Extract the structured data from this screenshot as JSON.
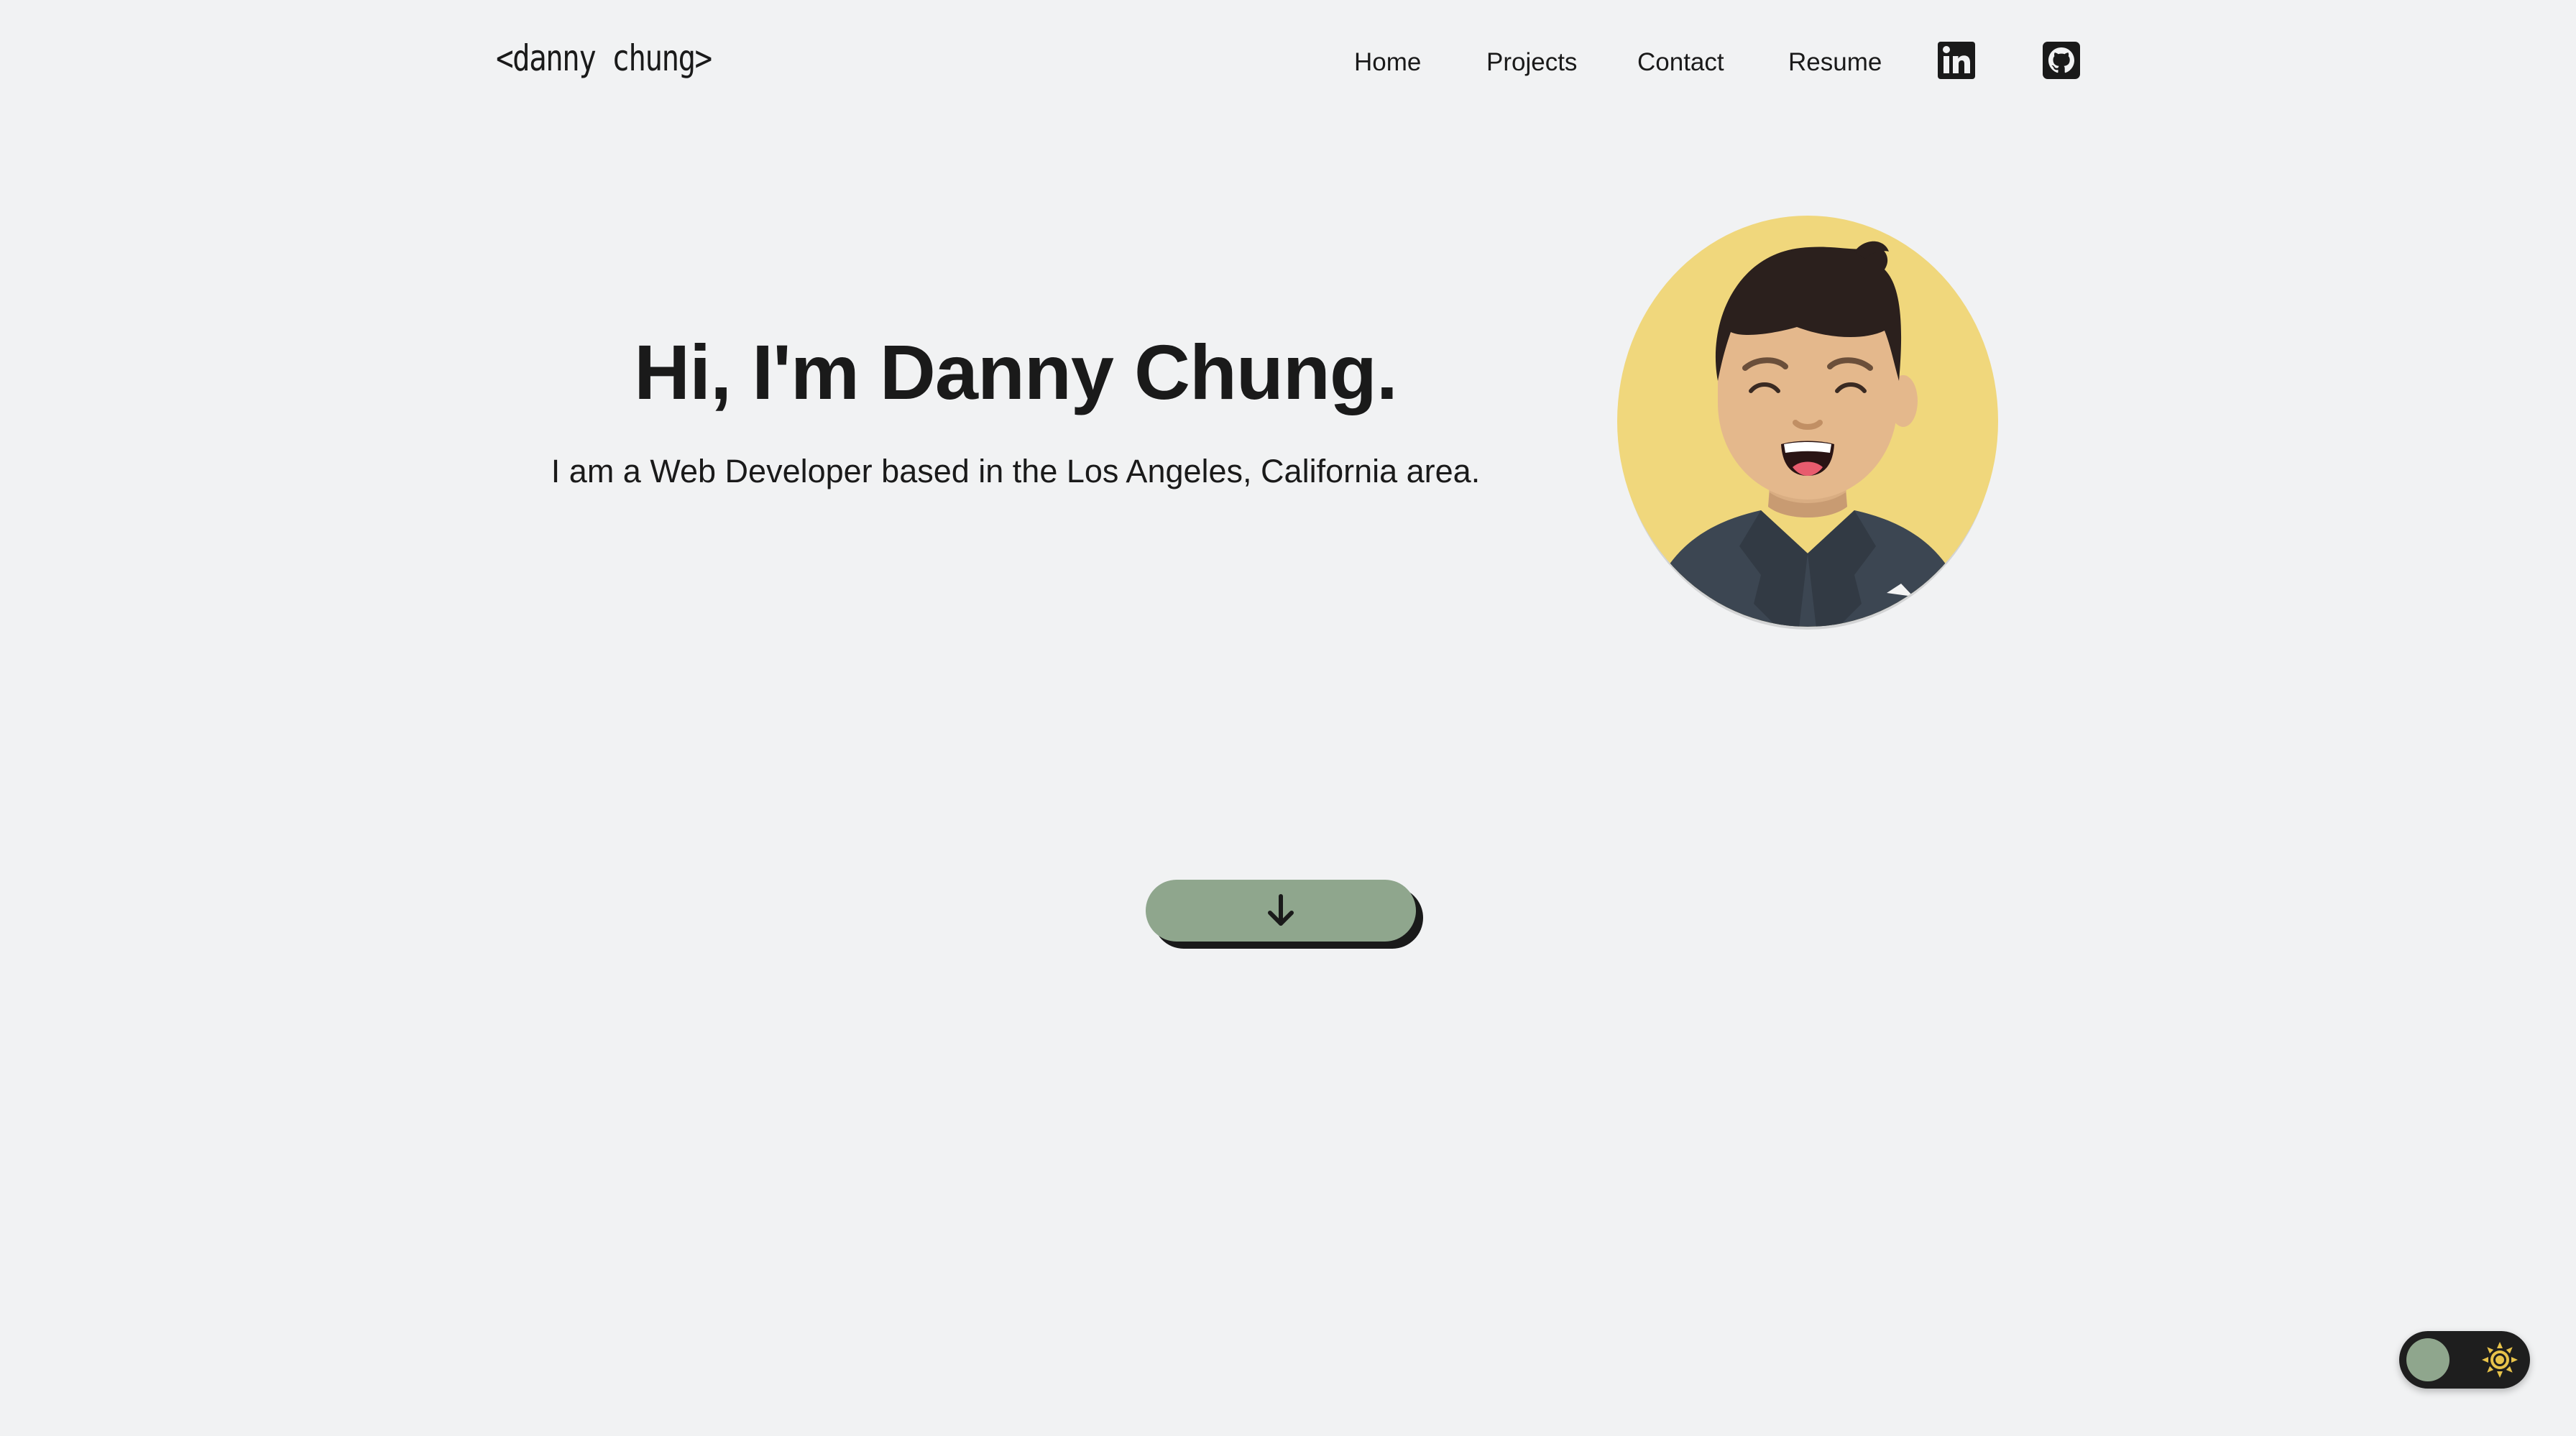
{
  "header": {
    "logo": "<danny chung>",
    "nav": [
      {
        "label": "Home"
      },
      {
        "label": "Projects"
      },
      {
        "label": "Contact"
      },
      {
        "label": "Resume"
      }
    ],
    "social": [
      {
        "icon": "linkedin-icon"
      },
      {
        "icon": "github-icon"
      }
    ]
  },
  "hero": {
    "title": "Hi, I'm Danny Chung.",
    "subtitle": "I am a Web Developer based in the Los Angeles, California area.",
    "avatar_icon": "avatar-illustration"
  },
  "scroll_button": {
    "icon": "arrow-down-icon",
    "color": "#8fa68d"
  },
  "theme_toggle": {
    "icon": "sun-icon",
    "mode": "light",
    "knob_color": "#8fa68d",
    "sun_color": "#e8c34a"
  },
  "colors": {
    "background": "#f1f2f3",
    "text": "#1a1a1a",
    "accent": "#8fa68d",
    "avatar_bg": "#f0d77c"
  }
}
